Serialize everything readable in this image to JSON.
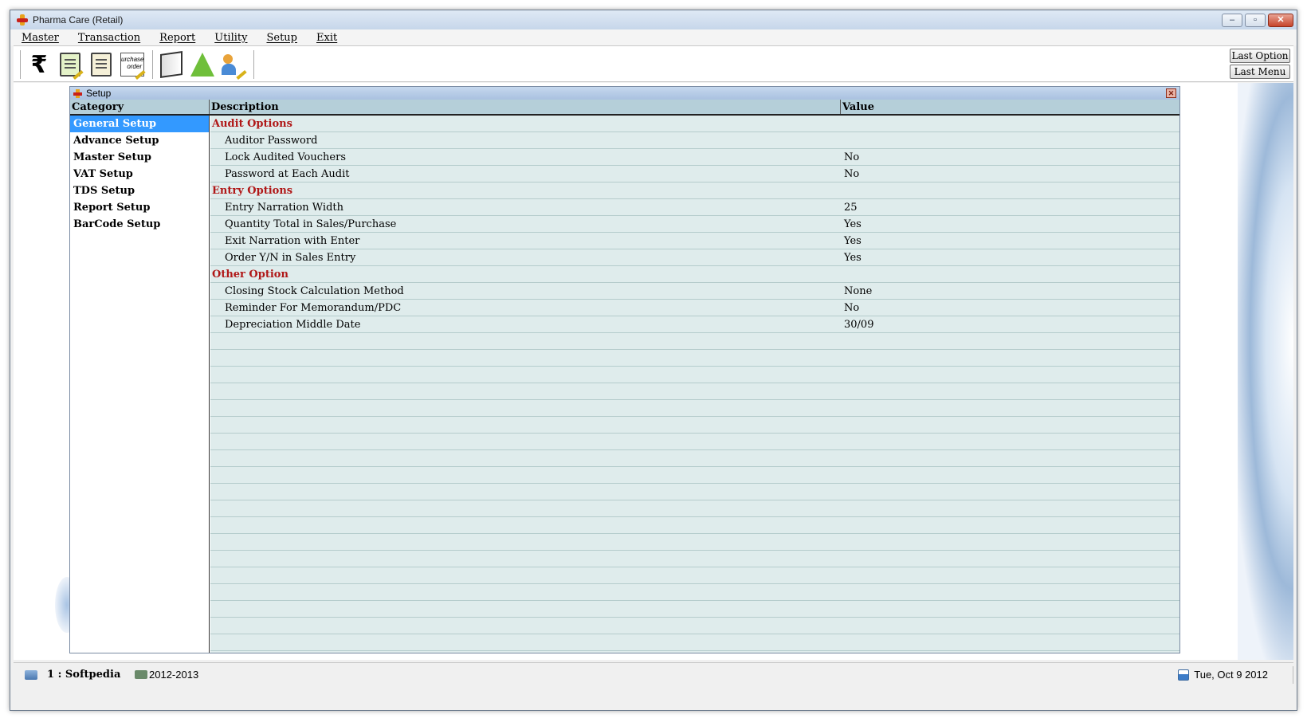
{
  "window": {
    "title": "Pharma Care (Retail)",
    "minimize": "–",
    "maximize": "▫",
    "close": "✕"
  },
  "menu": [
    "Master",
    "Transaction",
    "Report",
    "Utility",
    "Setup",
    "Exit"
  ],
  "toolbar": {
    "rupee_symbol": "₹",
    "purchase_order_label": "urchase\norder",
    "icons": [
      "rupee-icon",
      "invoice-icon",
      "clipboard-icon",
      "purchase-order-icon",
      "book-icon",
      "flask-icon",
      "user-edit-icon"
    ],
    "last_option": "Last Option",
    "last_menu": "Last Menu"
  },
  "setup": {
    "title": "Setup",
    "close": "✕",
    "headers": {
      "category": "Category",
      "description": "Description",
      "value": "Value"
    },
    "categories": [
      "General Setup",
      "Advance Setup",
      "Master Setup",
      "VAT Setup",
      "TDS Setup",
      "Report Setup",
      "BarCode Setup"
    ],
    "active_category": "General Setup",
    "rows": [
      {
        "desc": "Audit Options",
        "value": "",
        "section": true
      },
      {
        "desc": "Auditor Password",
        "value": ""
      },
      {
        "desc": "Lock Audited Vouchers",
        "value": "No"
      },
      {
        "desc": "Password at Each Audit",
        "value": "No"
      },
      {
        "desc": "Entry Options",
        "value": "",
        "section": true
      },
      {
        "desc": "Entry Narration Width",
        "value": "25"
      },
      {
        "desc": "Quantity Total in Sales/Purchase",
        "value": "Yes"
      },
      {
        "desc": "Exit Narration with Enter",
        "value": "Yes"
      },
      {
        "desc": "Order Y/N in Sales Entry",
        "value": "Yes"
      },
      {
        "desc": "Other Option",
        "value": "",
        "section": true
      },
      {
        "desc": "Closing Stock Calculation Method",
        "value": "None"
      },
      {
        "desc": "Reminder For Memorandum/PDC",
        "value": "No"
      },
      {
        "desc": "Depreciation Middle Date",
        "value": "30/09"
      }
    ]
  },
  "status": {
    "company": "1 : Softpedia",
    "year": "2012-2013",
    "date": "Tue, Oct 9 2012"
  },
  "colors": {
    "accent": "#3399ff",
    "section": "#b01818",
    "grid_bg": "#dfecec",
    "header_bg": "#b5cfd9"
  }
}
